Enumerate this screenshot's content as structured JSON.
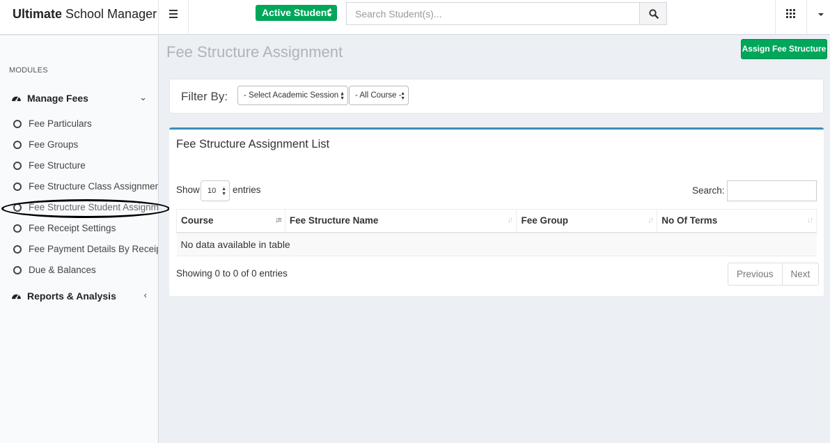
{
  "header": {
    "logo_bold": "Ultimate",
    "logo_rest": " School Manager",
    "status_select": "Active Student",
    "search_placeholder": "Search Student(s)..."
  },
  "sidebar": {
    "section_label": "MODULES",
    "groups": [
      {
        "label": "Manage Fees",
        "expanded": true,
        "icon": "dashboard-icon"
      },
      {
        "label": "Reports & Analysis",
        "expanded": false,
        "icon": "dashboard-icon"
      }
    ],
    "items": [
      {
        "label": "Fee Particulars"
      },
      {
        "label": "Fee Groups"
      },
      {
        "label": "Fee Structure"
      },
      {
        "label": "Fee Structure Class Assignment"
      },
      {
        "label": "Fee Structure Student Assignment",
        "highlighted": true
      },
      {
        "label": "Fee Receipt Settings"
      },
      {
        "label": "Fee Payment Details By Receipt No"
      },
      {
        "label": "Due & Balances"
      }
    ]
  },
  "main": {
    "page_title": "Fee Structure Assignment",
    "assign_button": "Assign Fee Structure",
    "filter": {
      "label": "Filter By:",
      "session_select": "- Select Academic Session -",
      "course_select": "- All Course -"
    },
    "list": {
      "title": "Fee Structure Assignment List",
      "show_label": "Show",
      "entries_value": "10",
      "entries_label": "entries",
      "search_label": "Search:",
      "columns": [
        "Course",
        "Fee Structure Name",
        "Fee Group",
        "No Of Terms"
      ],
      "empty_message": "No data available in table",
      "showing_text": "Showing 0 to 0 of 0 entries",
      "prev_label": "Previous",
      "next_label": "Next"
    }
  },
  "colors": {
    "accent_green": "#00a65a",
    "box_border_blue": "#3c8dbc",
    "background": "#ecf0f5"
  }
}
